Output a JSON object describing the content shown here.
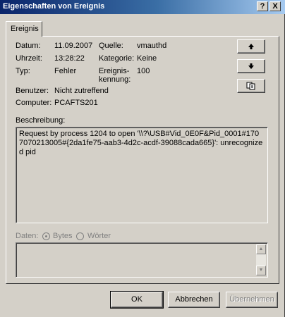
{
  "window": {
    "title": "Eigenschaften von Ereignis",
    "help_button": "?",
    "close_button": "X"
  },
  "tabs": [
    {
      "label": "Ereignis"
    }
  ],
  "fields": {
    "datum_label": "Datum:",
    "datum_value": "11.09.2007",
    "uhrzeit_label": "Uhrzeit:",
    "uhrzeit_value": "13:28:22",
    "typ_label": "Typ:",
    "typ_value": "Fehler",
    "benutzer_label": "Benutzer:",
    "benutzer_value": "Nicht zutreffend",
    "computer_label": "Computer:",
    "computer_value": "PCAFTS201",
    "quelle_label": "Quelle:",
    "quelle_value": "vmauthd",
    "kategorie_label": "Kategorie:",
    "kategorie_value": "Keine",
    "ereignis_label_1": "Ereignis-",
    "ereignis_label_2": "kennung:",
    "ereignis_value": "100"
  },
  "side_buttons": {
    "up_icon": "up-arrow-icon",
    "down_icon": "down-arrow-icon",
    "copy_icon": "copy-icon"
  },
  "description": {
    "label": "Beschreibung:",
    "text": "Request by process 1204 to open '\\\\?\\USB#Vid_0E0F&Pid_0001#1707070213005#{2da1fe75-aab3-4d2c-acdf-39088cada665}': unrecognized pid"
  },
  "data_section": {
    "label": "Daten:",
    "option_bytes": "Bytes",
    "option_words": "Wörter",
    "selected": "Bytes"
  },
  "buttons": {
    "ok": "OK",
    "cancel": "Abbrechen",
    "apply": "Übernehmen"
  }
}
